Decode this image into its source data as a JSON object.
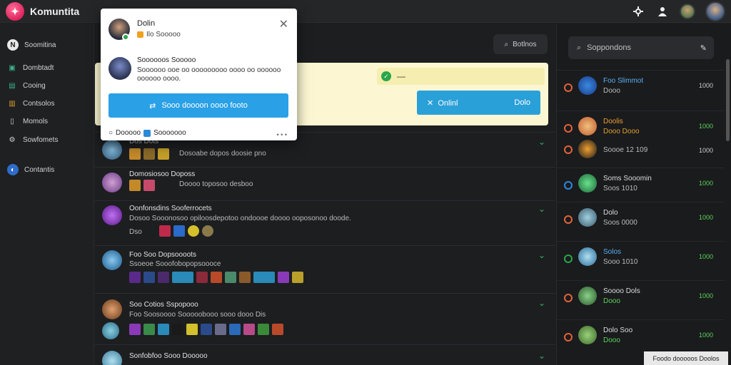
{
  "topbar": {
    "brand": "Komuntita",
    "icons": [
      "gear-icon",
      "person-icon"
    ]
  },
  "leftnav": [
    {
      "label": "Soomitina",
      "icon": "home-icon"
    },
    {
      "label": "Dombtadt",
      "icon": "controller-icon"
    },
    {
      "label": "Cooing",
      "icon": "screen-icon"
    },
    {
      "label": "Contsolos",
      "icon": "book-icon"
    },
    {
      "label": "Momols",
      "icon": "tablet-icon"
    },
    {
      "label": "Sowfomets",
      "icon": "settings-icon"
    },
    {
      "label": "Contantis",
      "icon": "globe-icon"
    }
  ],
  "main": {
    "search_label": "Botlnos",
    "banner": {
      "pill_text": "—",
      "button_left": "Onlinl",
      "button_right": "Dolo"
    },
    "posts": [
      {
        "name": "Dos Dots",
        "meta": "Dosoabe dopos doosie pno",
        "icon": "pin-icon"
      },
      {
        "name": "Domosiosoo  Doposs",
        "meta": "Doooo toposoo desboo",
        "icon": "pin-icon"
      },
      {
        "name": "Oonfonsdins  Sooferrocets",
        "meta": "Dosoo  Sooonosoo opiloosdepotoo ondoooe doooo ooposonoo doode.",
        "meta2": "Dso",
        "icon": "pin-icon"
      },
      {
        "name": "Foo  Soo  Dopsoooots",
        "meta": "Ssoeoe  Sooofobopopsoooce",
        "icon": "pin-icon"
      },
      {
        "name": "Soo Cotios  Sspopooo",
        "meta": "Foo  Soosoooo  Sooooobooo sooo dooo Dis",
        "icon": "pin-icon"
      },
      {
        "name": "Sonfobfoo  Sooo Dooooo",
        "meta": "",
        "icon": "pin-icon"
      }
    ]
  },
  "rightpanel": {
    "search_placeholder": "Soppondons",
    "items": [
      {
        "name": "Foo Slimmot",
        "sub": "Dooo",
        "value": "1000",
        "green": false
      },
      {
        "name": "Doolis",
        "sub": "Dooo  Dooo",
        "value": "1000",
        "green": true
      },
      {
        "name": "",
        "sub": "Soooe  12 109",
        "value": "1000",
        "green": false
      },
      {
        "name": "Soms Sooomin",
        "sub": "Soos  1010",
        "value": "1000",
        "green": true
      },
      {
        "name": "Dolo",
        "sub": "Soos  0000",
        "value": "1000",
        "green": true
      },
      {
        "name": "Solos",
        "sub": "Sooo  1010",
        "value": "1000",
        "green": true
      },
      {
        "name": "Soooo Dols",
        "sub": "Dooo",
        "value": "1000",
        "green": true
      },
      {
        "name": "Dolo Soo",
        "sub": "Dooo",
        "value": "1000",
        "green": true
      }
    ],
    "toast": "Foodo dooooos Doolos"
  },
  "popup": {
    "user_name": "Dolin",
    "user_sub": "Ilo  Sooooo",
    "title": "Soooooos  Sooooo",
    "desc": "Soooooo ooe oo ooooooooo oooo oo oooooo oooooo oooo.",
    "button": "Sooo doooon oooo footo",
    "foot_left": "Dooooo",
    "foot_right": "Sooooooo",
    "dots": "• • •"
  }
}
